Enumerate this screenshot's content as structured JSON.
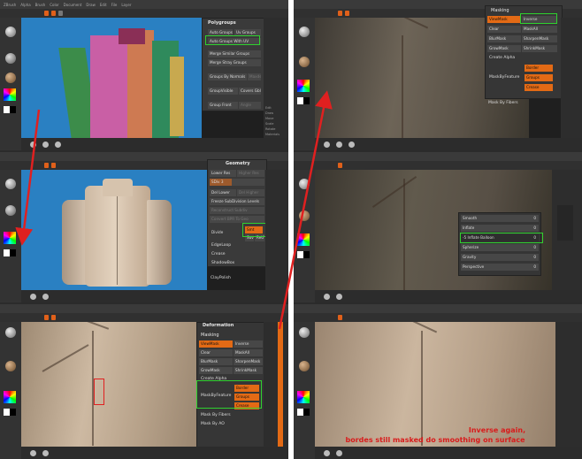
{
  "panel1": {
    "menu_items": [
      "ZBrush",
      "Alpha",
      "Brush",
      "Color",
      "Document",
      "Draw",
      "Edit",
      "File",
      "Layer"
    ],
    "polygroups_title": "Polygroups",
    "buttons": [
      "Auto Groups",
      "Uv Groups",
      "Auto Groups With UV",
      "Merge Similar Groups",
      "Merge Stray Groups",
      "Groups By Normals",
      "Maxdeg",
      "GroupVisible",
      "Covers Gbls",
      "Group Front",
      "Angle"
    ],
    "side_labels": [
      "Edit",
      "Draw",
      "Move",
      "Scale",
      "Rotate",
      "Materials"
    ]
  },
  "panel2": {
    "geometry_title": "Geometry",
    "buttons": [
      "Lower Res",
      "Higher Res",
      "SDiv 3",
      "Del Lower",
      "Del Higher",
      "Freeze SubDivision Levels",
      "Reconstruct Subdiv",
      "Convert BPR To Geo",
      "Divide",
      "Smt",
      "Suv",
      "ReUV",
      "EdgeLoop",
      "Crease",
      "ShadowBox",
      "ClayPolish"
    ]
  },
  "panel3": {
    "deformation_title": "Deformation",
    "masking_title": "Masking",
    "buttons": [
      "ViewMask",
      "Inverse",
      "Clear",
      "MaskAll",
      "BlurMask",
      "SharpenMask",
      "GrowMask",
      "ShrinkMask",
      "Create Alpha",
      "MaskByFeature",
      "Border",
      "Groups",
      "Crease",
      "Mask By Fibers",
      "Mask By AO"
    ]
  },
  "panel4": {
    "masking_title": "Masking",
    "buttons": [
      "ViewMask",
      "Inverse",
      "Clear",
      "MaskAll",
      "BlurMask",
      "SharpenMask",
      "GrowMask",
      "ShrinkMask",
      "Create Alpha",
      "MaskByFeature",
      "Border",
      "Groups",
      "Crease",
      "Mask By Fibers"
    ]
  },
  "panel5": {
    "sliders": [
      {
        "label": "Smooth",
        "value": "0"
      },
      {
        "label": "Inflate",
        "value": "0"
      },
      {
        "label": "-5 Inflate Balloon",
        "value": "0"
      },
      {
        "label": "Spherize",
        "value": "0"
      },
      {
        "label": "Gravity",
        "value": "0"
      },
      {
        "label": "Perspective",
        "value": "0"
      }
    ]
  },
  "panel6": {
    "caption_line1": "Inverse again,",
    "caption_line2": "bordes still masked do smoothing on surface"
  },
  "colors": {
    "accent": "#e36a15",
    "highlight_green": "#2fd12f",
    "arrow_red": "#e02020",
    "viewport_blue": "#2a80c2"
  }
}
